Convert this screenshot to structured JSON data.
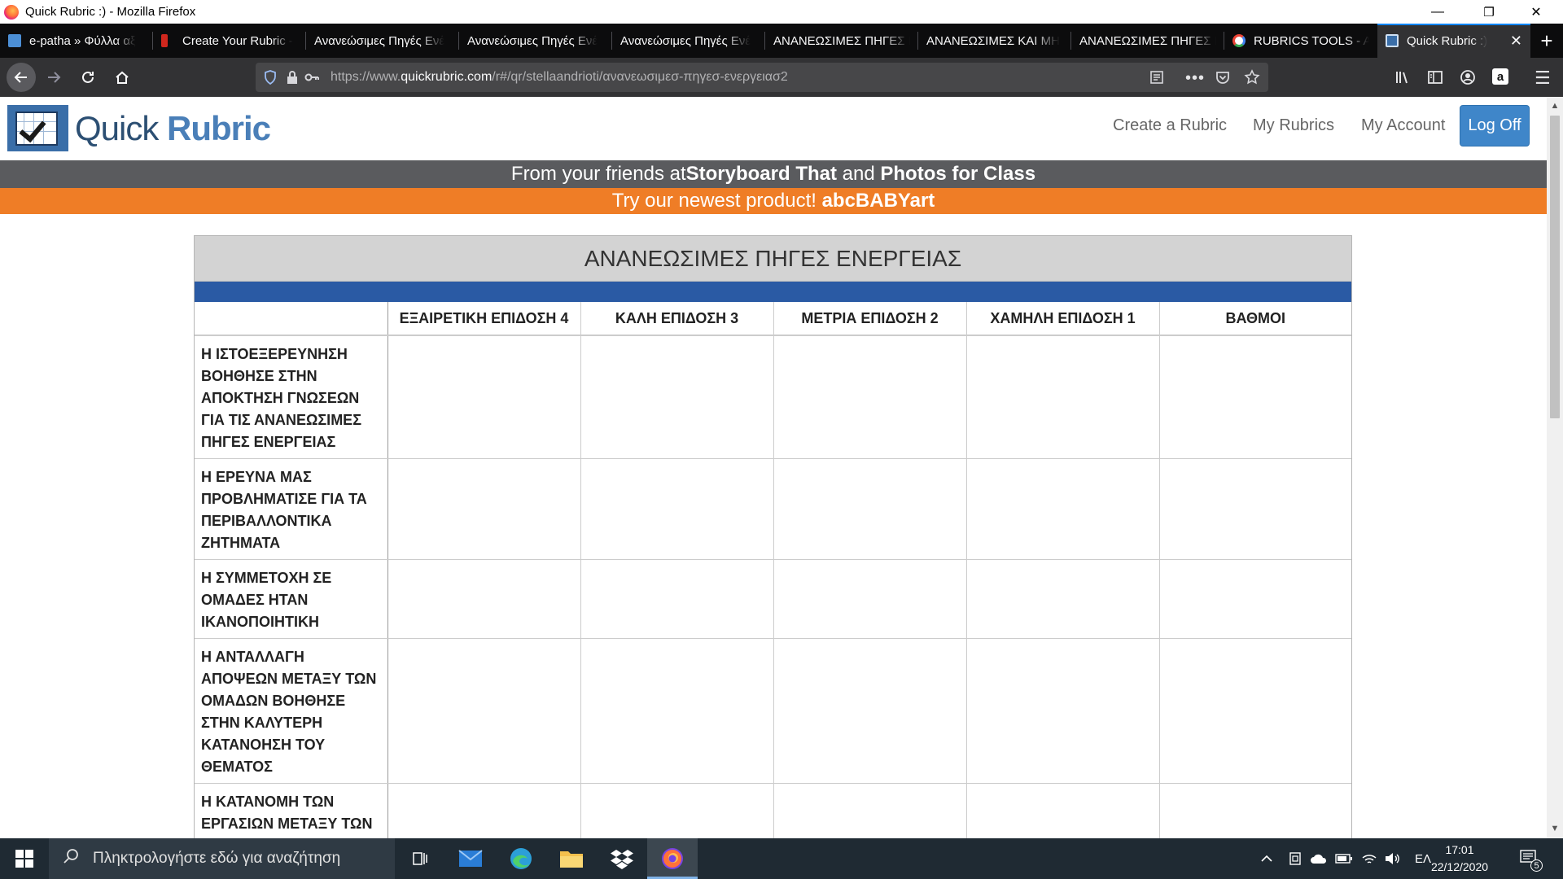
{
  "window": {
    "title": "Quick Rubric :) - Mozilla Firefox",
    "minimize": "—",
    "restore": "❐",
    "close": "✕"
  },
  "tabs": [
    {
      "label": "e-patha » Φύλλα αξ",
      "favicon_color": "#4c8fd6"
    },
    {
      "label": "Create Your Rubric -",
      "favicon_color": "#d0271d"
    },
    {
      "label": "Ανανεώσιμες Πηγές Ενέ",
      "favicon_color": ""
    },
    {
      "label": "Ανανεώσιμες Πηγές Ενέ",
      "favicon_color": ""
    },
    {
      "label": "Ανανεώσιμες Πηγές Ενέ",
      "favicon_color": ""
    },
    {
      "label": "ΑΝΑΝΕΩΣΙΜΕΣ ΠΗΓΕΣ Ε",
      "favicon_color": ""
    },
    {
      "label": "ΑΝΑΝΕΩΣΙΜΕΣ ΚΑΙ ΜΗ",
      "favicon_color": ""
    },
    {
      "label": "ΑΝΑΝΕΩΣΙΜΕΣ ΠΗΓΕΣ Ε",
      "favicon_color": ""
    },
    {
      "label": "RUBRICS TOOLS - A",
      "favicon_color": "#ea4335"
    },
    {
      "label": "Quick Rubric :)",
      "favicon_color": "#3a6ea8",
      "active": true
    }
  ],
  "toolbar": {
    "new_tab": "+",
    "url_prefix": "https://www.",
    "url_domain": "quickrubric.com",
    "url_path": "/r#/qr/stellaandrioti/ανανεωσιμεσ-πηγεσ-ενεργειασ2"
  },
  "site": {
    "logo_quick": "Quick",
    "logo_rubric": "Rubric",
    "nav": [
      "Create a Rubric",
      "My Rubrics",
      "My Account"
    ],
    "logoff": "Log Off",
    "promo_line1_pre": "From your friends at ",
    "promo_line1_b1": "Storyboard That",
    "promo_line1_mid": " and ",
    "promo_line1_b2": "Photos for Class",
    "promo_line2_pre": "Try our newest product! ",
    "promo_line2_b": "abcBABYart"
  },
  "rubric": {
    "title": "ΑΝΑΝΕΩΣΙΜΕΣ ΠΗΓΕΣ ΕΝΕΡΓΕΙΑΣ",
    "columns": [
      "",
      "ΕΞΑΙΡΕΤΙΚΗ ΕΠΙΔΟΣΗ 4",
      "ΚΑΛΗ ΕΠΙΔΟΣΗ 3",
      "ΜΕΤΡΙΑ ΕΠΙΔΟΣΗ 2",
      "ΧΑΜΗΛΗ ΕΠΙΔΟΣΗ 1",
      "ΒΑΘΜΟΙ"
    ],
    "rows": [
      "Η ΙΣΤΟΕΞΕΡΕΥΝΗΣΗ ΒΟΗΘΗΣΕ ΣΤΗΝ ΑΠΟΚΤΗΣΗ ΓΝΩΣΕΩΝ ΓΙΑ ΤΙΣ ΑΝΑΝΕΩΣΙΜΕΣ ΠΗΓΕΣ ΕΝΕΡΓΕΙΑΣ",
      "Η ΕΡΕΥΝΑ ΜΑΣ ΠΡΟΒΛΗΜΑΤΙΣΕ ΓΙΑ ΤΑ ΠΕΡΙΒΑΛΛΟΝΤΙΚΑ ΖΗΤΗΜΑΤΑ",
      "Η ΣΥΜΜΕΤΟΧΗ ΣΕ ΟΜΑΔΕΣ ΗΤΑΝ ΙΚΑΝΟΠΟΙΗΤΙΚΗ",
      "Η ΑΝΤΑΛΛΑΓΗ ΑΠΟΨΕΩΝ ΜΕΤΑΞΥ ΤΩΝ ΟΜΑΔΩΝ ΒΟΗΘΗΣΕ ΣΤΗΝ ΚΑΛΥΤΕΡΗ ΚΑΤΑΝΟΗΣΗ ΤΟΥ ΘΕΜΑΤΟΣ",
      "Η ΚΑΤΑΝΟΜΗ ΤΩΝ ΕΡΓΑΣΙΩΝ ΜΕΤΑΞΥ ΤΩΝ ΜΕΛΩΝ ΤΗΣ ΟΜΑΔΑΣ"
    ]
  },
  "taskbar": {
    "search_placeholder": "Πληκτρολογήστε εδώ για αναζήτηση",
    "language": "ΕΛ",
    "time": "17:01",
    "date": "22/12/2020",
    "notifications": "5"
  }
}
